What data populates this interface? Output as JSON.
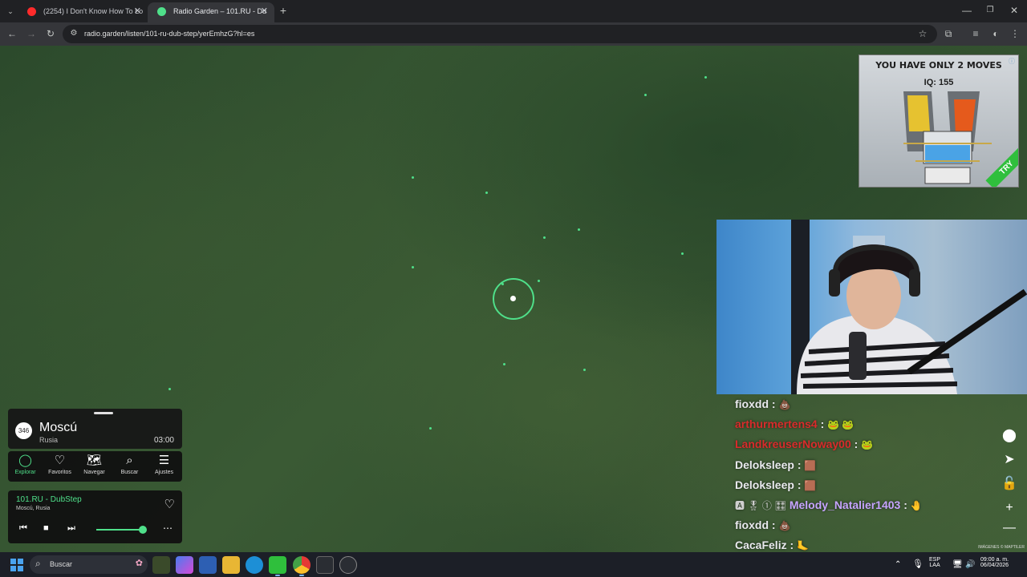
{
  "browser": {
    "tabs": [
      {
        "title": "(2254) I Don't Know How To Lo"
      },
      {
        "title": "Radio Garden – 101.RU - Du"
      }
    ],
    "url": "radio.garden/listen/101-ru-dub-step/yerEmhzG?hl=es"
  },
  "ad": {
    "title": "YOU HAVE ONLY 2 MOVES",
    "iq": "IQ: 155",
    "cta": "TRY"
  },
  "chat": [
    {
      "user": "fioxdd",
      "color": "#e9e9ee",
      "emote": "💩"
    },
    {
      "user": "arthurmertens4",
      "color": "#d92b2b",
      "emote": "🐸 🐸"
    },
    {
      "user": "LandkreuserNoway00",
      "color": "#d92b2b",
      "emote": "🐸"
    },
    {
      "user": "Deloksleep",
      "color": "#e9e9ee",
      "emote": "🟫"
    },
    {
      "user": "Deloksleep",
      "color": "#e9e9ee",
      "emote": "🟫"
    },
    {
      "user": "Melody_Natalier1403",
      "color": "#c6a4ff",
      "emote": "🤚"
    },
    {
      "user": "fioxdd",
      "color": "#e9e9ee",
      "emote": "💩"
    },
    {
      "user": "CacaFeliz",
      "color": "#e9e9ee",
      "emote": "🦶"
    }
  ],
  "map": {
    "attribution": "IMÁGENES © MAPTILER"
  },
  "place": {
    "count": "346",
    "city": "Moscú",
    "country": "Rusia",
    "time": "03:00"
  },
  "nav": [
    {
      "label": "Explorar",
      "icon": "explore-icon"
    },
    {
      "label": "Favoritos",
      "icon": "heart-icon"
    },
    {
      "label": "Navegar",
      "icon": "map-icon"
    },
    {
      "label": "Buscar",
      "icon": "search-icon"
    },
    {
      "label": "Ajustes",
      "icon": "menu-icon"
    }
  ],
  "player": {
    "station": "101.RU - DubStep",
    "location": "Moscú, Rusia",
    "volume": 1.0
  },
  "taskbar": {
    "search_label": "Buscar",
    "lang": "ESP",
    "layout": "LAA",
    "time": "09:00 a. m.",
    "date": "06/04/2026"
  },
  "colors": {
    "accent": "#4fe08a",
    "chat_red": "#d92b2b"
  }
}
